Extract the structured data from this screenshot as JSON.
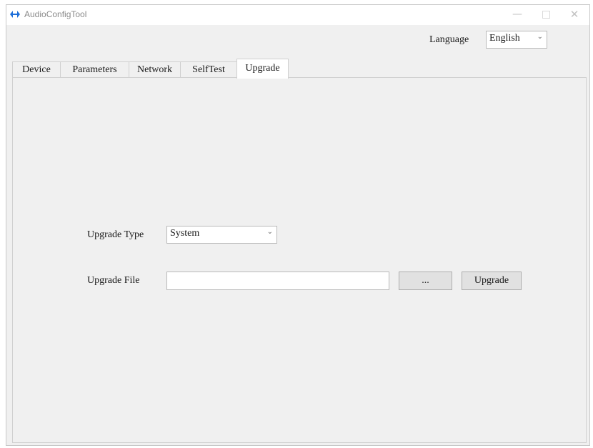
{
  "window": {
    "title": "AudioConfigTool",
    "controls": {
      "minimize": "—",
      "close": "✕"
    }
  },
  "language": {
    "label": "Language",
    "selected": "English"
  },
  "tabs": [
    {
      "label": "Device",
      "active": false
    },
    {
      "label": "Parameters",
      "active": false
    },
    {
      "label": "Network",
      "active": false
    },
    {
      "label": "SelfTest",
      "active": false
    },
    {
      "label": "Upgrade",
      "active": true
    }
  ],
  "upgrade": {
    "type_label": "Upgrade Type",
    "type_selected": "System",
    "file_label": "Upgrade File",
    "file_value": "",
    "browse_label": "...",
    "upgrade_button": "Upgrade"
  },
  "icons": {
    "app": "app-logo-icon",
    "chevron": "chevron-down-icon"
  },
  "colors": {
    "window_bg": "#f0f0f0",
    "accent": "#1e6fd9"
  }
}
